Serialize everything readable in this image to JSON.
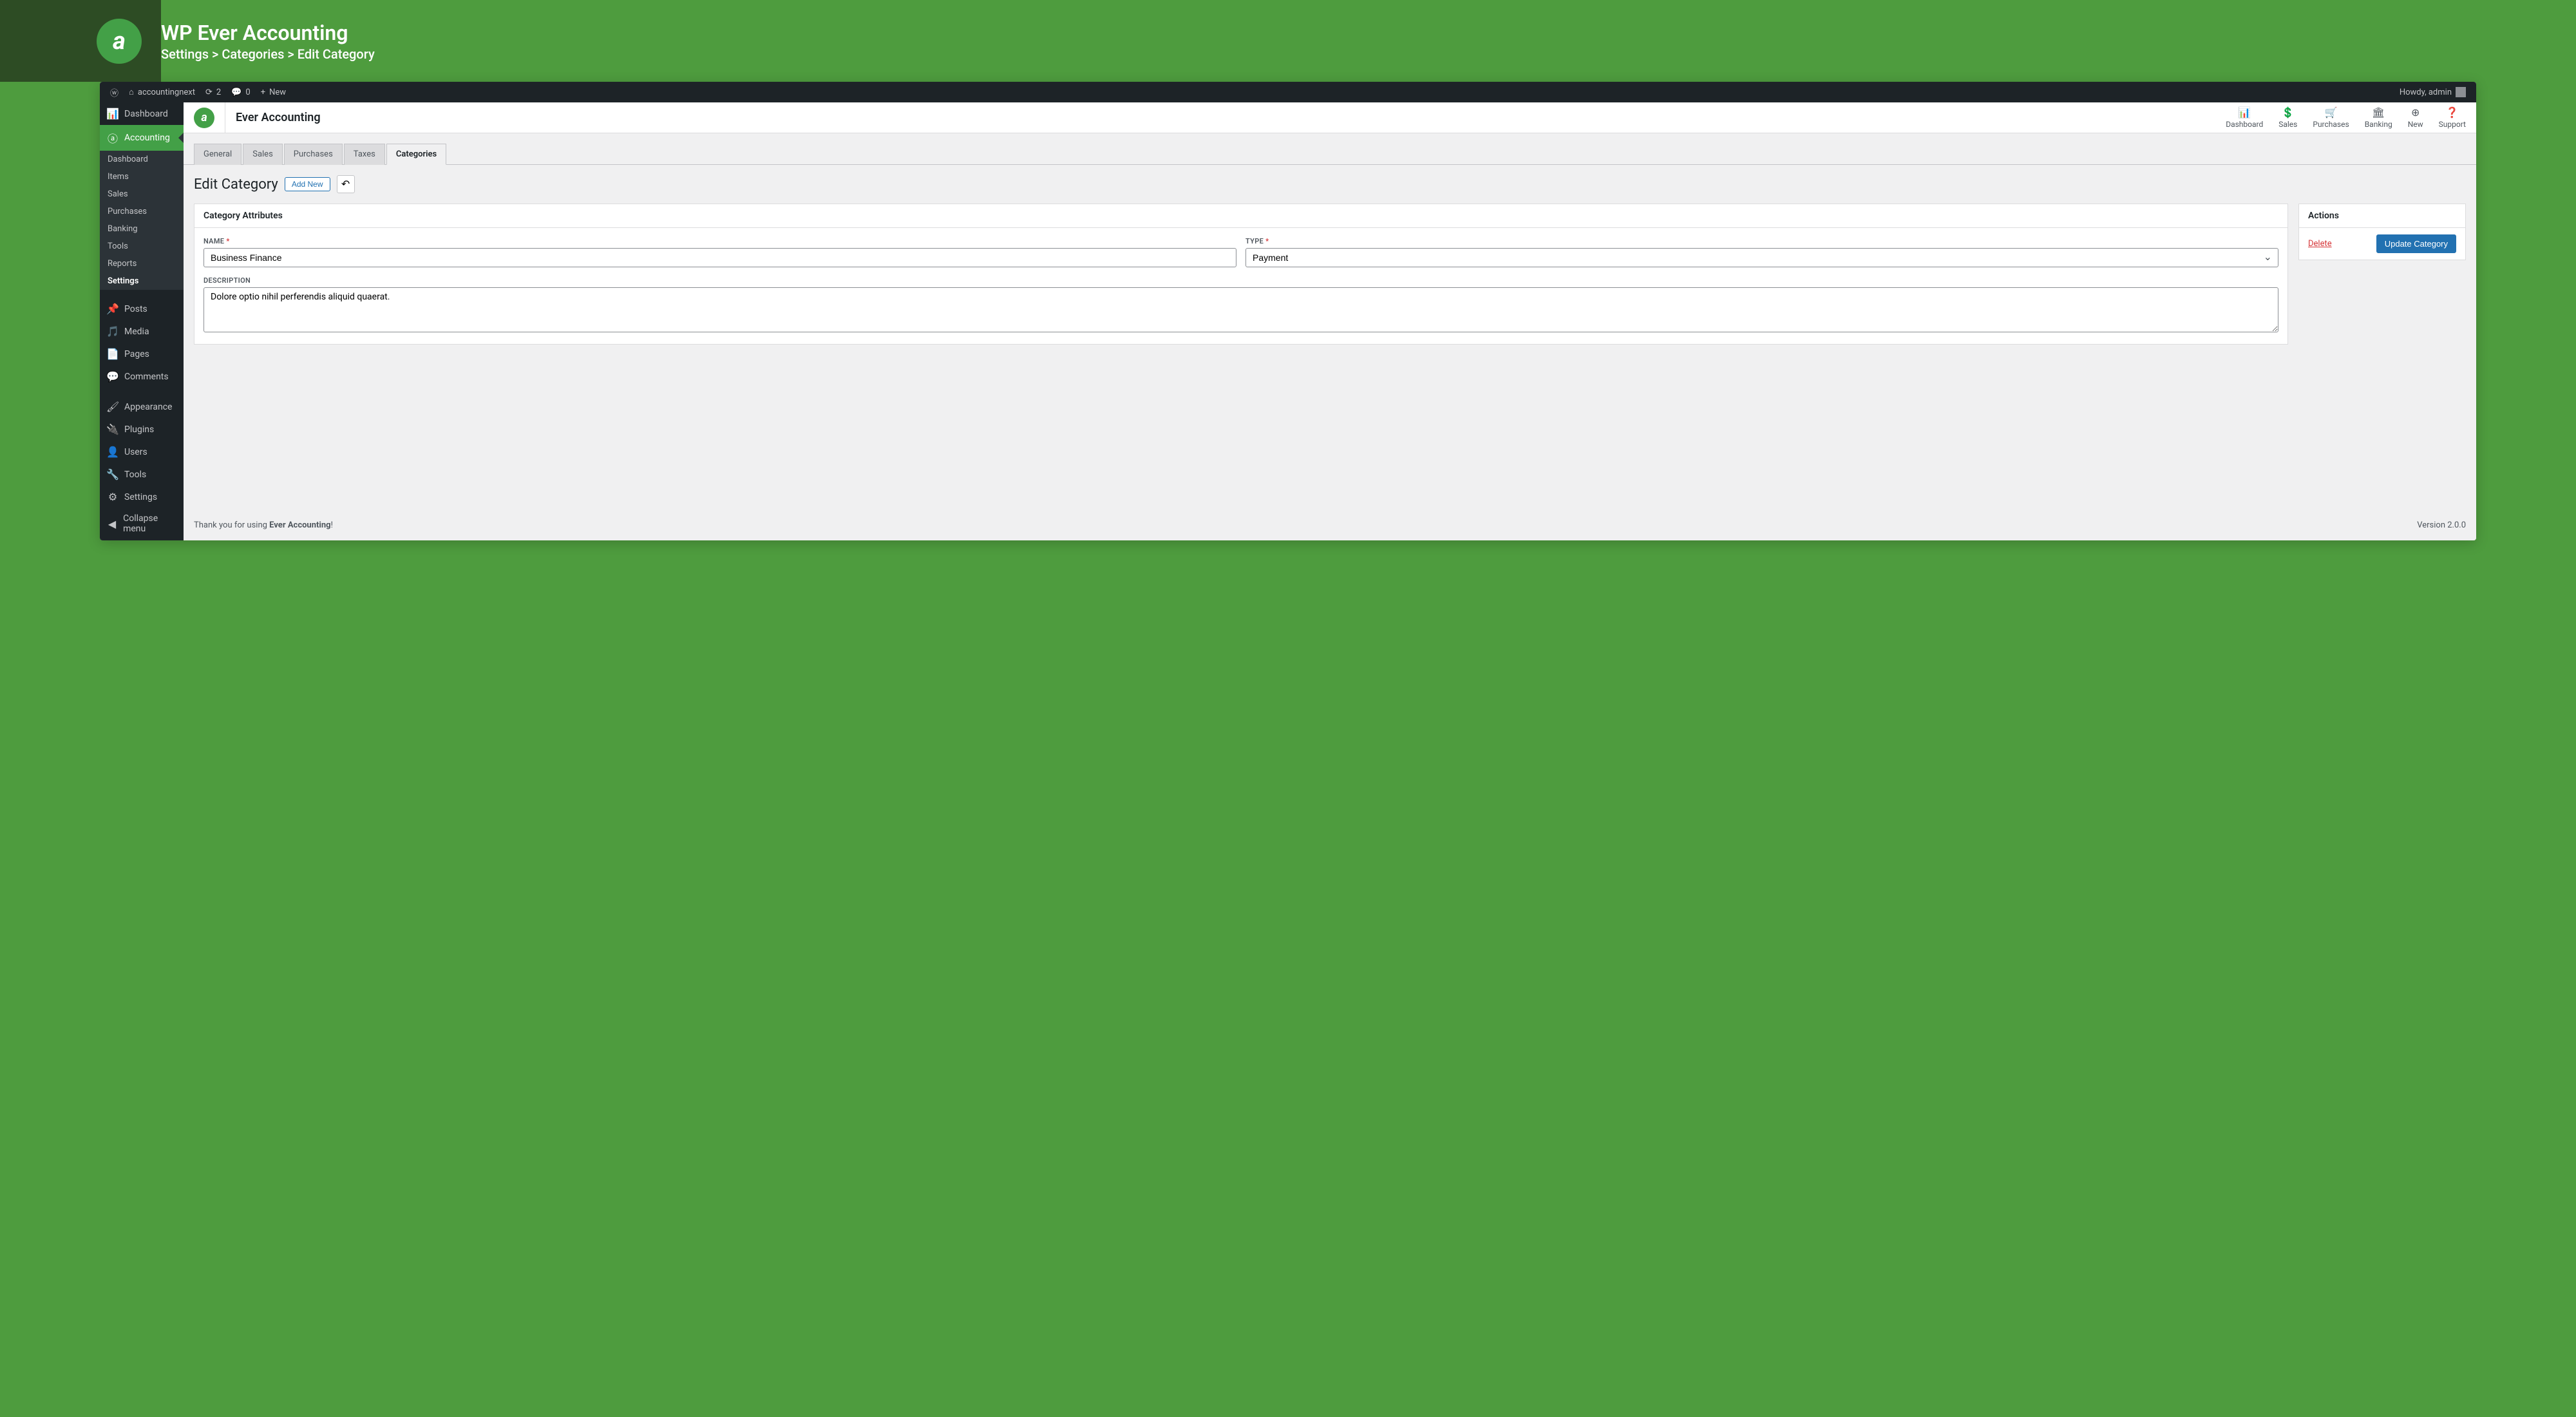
{
  "header": {
    "title": "WP Ever Accounting",
    "breadcrumb": "Settings > Categories > Edit Category"
  },
  "adminbar": {
    "site_name": "accountingnext",
    "updates_count": "2",
    "comments_count": "0",
    "new_label": "New",
    "howdy": "Howdy, admin"
  },
  "wpmenu": {
    "dashboard": "Dashboard",
    "accounting": "Accounting",
    "submenu": {
      "dashboard": "Dashboard",
      "items": "Items",
      "sales": "Sales",
      "purchases": "Purchases",
      "banking": "Banking",
      "tools": "Tools",
      "reports": "Reports",
      "settings": "Settings"
    },
    "posts": "Posts",
    "media": "Media",
    "pages": "Pages",
    "comments": "Comments",
    "appearance": "Appearance",
    "plugins": "Plugins",
    "users": "Users",
    "tools": "Tools",
    "settings": "Settings",
    "collapse": "Collapse menu"
  },
  "ea_header": {
    "title": "Ever Accounting",
    "nav": {
      "dashboard": "Dashboard",
      "sales": "Sales",
      "purchases": "Purchases",
      "banking": "Banking",
      "new": "New",
      "support": "Support"
    }
  },
  "tabs": {
    "general": "General",
    "sales": "Sales",
    "purchases": "Purchases",
    "taxes": "Taxes",
    "categories": "Categories"
  },
  "page": {
    "title": "Edit Category",
    "add_new": "Add New"
  },
  "form": {
    "panel_title": "Category Attributes",
    "name_label": "NAME",
    "name_value": "Business Finance",
    "type_label": "TYPE",
    "type_value": "Payment",
    "desc_label": "DESCRIPTION",
    "desc_value": "Dolore optio nihil perferendis aliquid quaerat."
  },
  "actions": {
    "title": "Actions",
    "delete": "Delete",
    "update": "Update Category"
  },
  "footer": {
    "thanks_prefix": "Thank you for using ",
    "thanks_bold": "Ever Accounting",
    "thanks_suffix": "!",
    "version": "Version 2.0.0"
  }
}
